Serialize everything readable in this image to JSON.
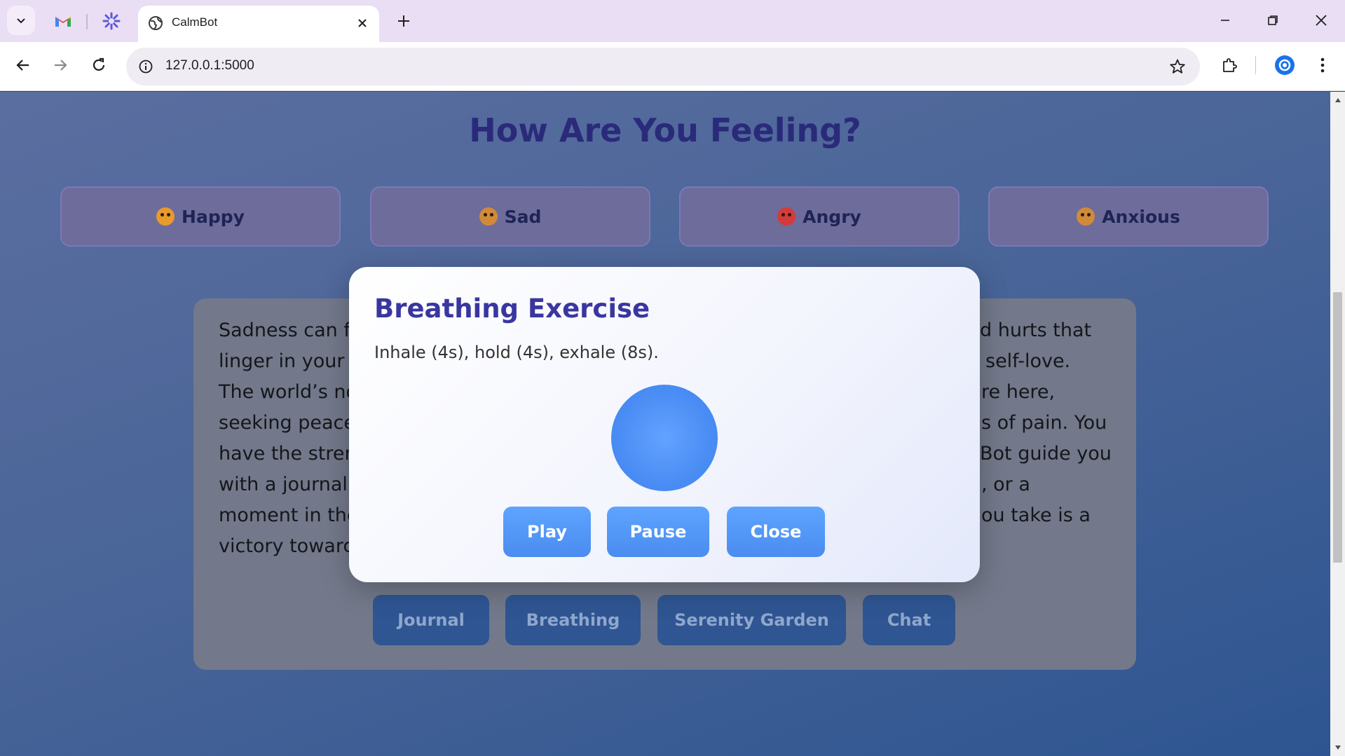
{
  "browser": {
    "tab_title": "CalmBot",
    "url": "127.0.0.1:5000"
  },
  "page": {
    "title": "How Are You Feeling?",
    "moods": [
      {
        "label": "Happy",
        "emoji_color": "#e89a2b"
      },
      {
        "label": "Sad",
        "emoji_color": "#d18a3a"
      },
      {
        "label": "Angry",
        "emoji_color": "#d53a3a"
      },
      {
        "label": "Anxious",
        "emoji_color": "#d18a3a"
      }
    ],
    "card_lines_left": [
      "Sadness can f",
      "linger in your h",
      "The world’s no",
      "seeking peace",
      "have the stren",
      "with a journal",
      "moment in the",
      "victory toward"
    ],
    "card_lines_right": [
      "d hurts that",
      "self-love.",
      "re here,",
      "s of pain. You",
      "Bot guide you",
      ", or a",
      "ou take is a",
      ""
    ],
    "features": [
      "Journal",
      "Breathing",
      "Serenity Garden",
      "Chat"
    ]
  },
  "modal": {
    "title": "Breathing Exercise",
    "instructions": "Inhale (4s), hold (4s), exhale (8s).",
    "play_label": "Play",
    "pause_label": "Pause",
    "close_label": "Close"
  },
  "colors": {
    "accent": "#3a36a0",
    "button_blue": "#4a8cf0",
    "page_bg": "#4a6598"
  }
}
